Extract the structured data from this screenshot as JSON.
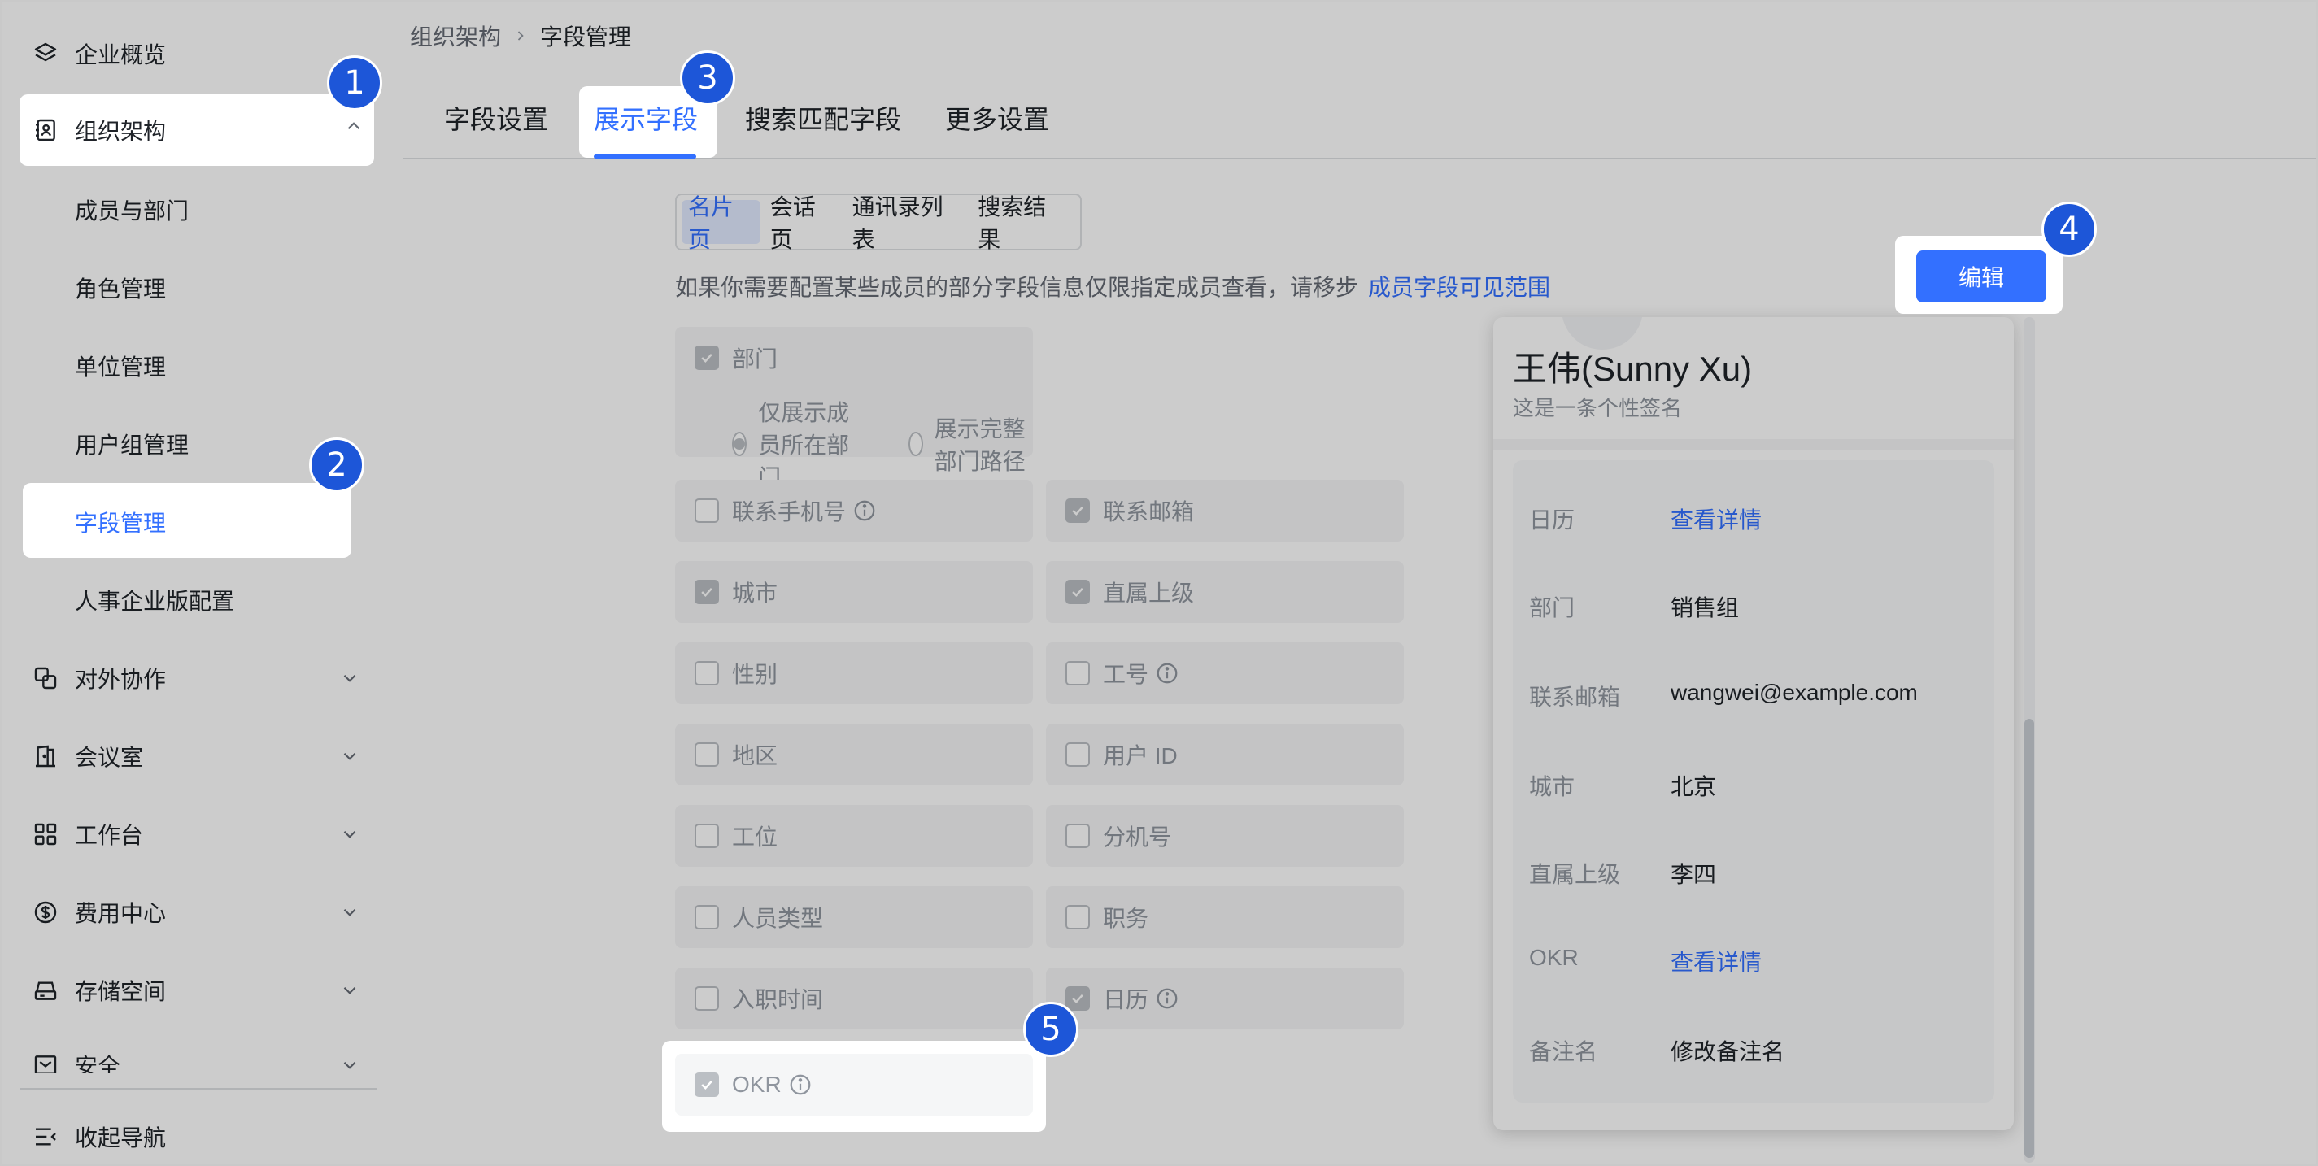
{
  "breadcrumb": {
    "parent": "组织架构",
    "current": "字段管理"
  },
  "sidebar": {
    "items": [
      {
        "label": "企业概览",
        "icon": "layers-icon"
      },
      {
        "label": "组织架构",
        "icon": "contact-book-icon",
        "expanded": true
      },
      {
        "label": "成员与部门"
      },
      {
        "label": "角色管理"
      },
      {
        "label": "单位管理"
      },
      {
        "label": "用户组管理"
      },
      {
        "label": "字段管理",
        "active": true
      },
      {
        "label": "人事企业版配置"
      },
      {
        "label": "对外协作",
        "icon": "external-collab-icon"
      },
      {
        "label": "会议室",
        "icon": "meeting-room-icon"
      },
      {
        "label": "工作台",
        "icon": "grid-icon"
      },
      {
        "label": "费用中心",
        "icon": "dollar-icon"
      },
      {
        "label": "存储空间",
        "icon": "storage-icon"
      },
      {
        "label": "安全",
        "icon": "security-icon"
      }
    ],
    "collapse_label": "收起导航"
  },
  "tabs": [
    {
      "label": "字段设置"
    },
    {
      "label": "展示字段",
      "active": true
    },
    {
      "label": "搜索匹配字段"
    },
    {
      "label": "更多设置"
    }
  ],
  "subtabs": [
    {
      "label": "名片页",
      "active": true
    },
    {
      "label": "会话页"
    },
    {
      "label": "通讯录列表"
    },
    {
      "label": "搜索结果"
    }
  ],
  "notice": {
    "text": "如果你需要配置某些成员的部分字段信息仅限指定成员查看，请移步",
    "link": "成员字段可见范围"
  },
  "edit_button": "编辑",
  "fields": {
    "department": {
      "label": "部门",
      "checked": true
    },
    "dept_options": [
      "仅展示成员所在部门",
      "展示完整部门路径"
    ],
    "grid": [
      {
        "label": "联系手机号",
        "checked": false,
        "info": true
      },
      {
        "label": "联系邮箱",
        "checked": true
      },
      {
        "label": "城市",
        "checked": true
      },
      {
        "label": "直属上级",
        "checked": true
      },
      {
        "label": "性别",
        "checked": false
      },
      {
        "label": "工号",
        "checked": false,
        "info": true
      },
      {
        "label": "地区",
        "checked": false
      },
      {
        "label": "用户 ID",
        "checked": false
      },
      {
        "label": "工位",
        "checked": false
      },
      {
        "label": "分机号",
        "checked": false
      },
      {
        "label": "人员类型",
        "checked": false
      },
      {
        "label": "职务",
        "checked": false
      },
      {
        "label": "入职时间",
        "checked": false
      },
      {
        "label": "日历",
        "checked": true,
        "info": true
      }
    ],
    "okr": {
      "label": "OKR",
      "checked": true,
      "info": true
    }
  },
  "preview": {
    "name": "王伟(Sunny Xu)",
    "signature": "这是一条个性签名",
    "rows": [
      {
        "label": "日历",
        "value": "查看详情",
        "link": true
      },
      {
        "label": "部门",
        "value": "销售组"
      },
      {
        "label": "联系邮箱",
        "value": "wangwei@example.com"
      },
      {
        "label": "城市",
        "value": "北京"
      },
      {
        "label": "直属上级",
        "value": "李四"
      },
      {
        "label": "OKR",
        "value": "查看详情",
        "link": true
      },
      {
        "label": "备注名",
        "value": "修改备注名"
      }
    ]
  },
  "badges": [
    "1",
    "2",
    "3",
    "4",
    "5"
  ],
  "colors": {
    "accent": "#3370ff",
    "badge": "#1d56d8"
  }
}
